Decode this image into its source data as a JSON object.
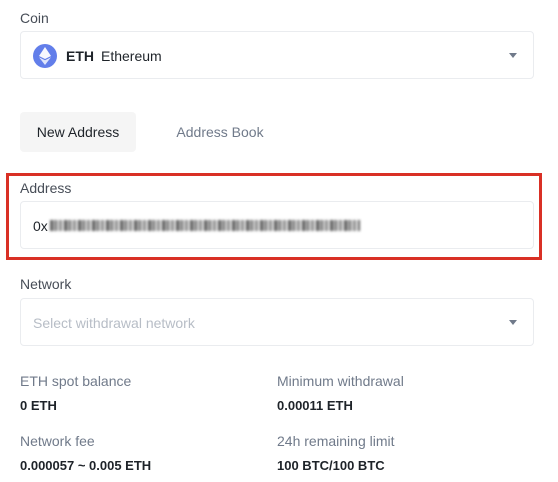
{
  "coin": {
    "label": "Coin",
    "symbol": "ETH",
    "name": "Ethereum",
    "icon": "ethereum-icon",
    "icon_color": "#627eea"
  },
  "tabs": [
    {
      "label": "New Address",
      "active": true
    },
    {
      "label": "Address Book",
      "active": false
    }
  ],
  "address": {
    "label": "Address",
    "prefix": "0x",
    "highlight_color": "#d93025"
  },
  "network": {
    "label": "Network",
    "placeholder": "Select withdrawal network"
  },
  "info": {
    "spot_balance_label": "ETH spot balance",
    "spot_balance_value": "0 ETH",
    "min_withdrawal_label": "Minimum withdrawal",
    "min_withdrawal_value": "0.00011 ETH",
    "network_fee_label": "Network fee",
    "network_fee_value": "0.000057 ~ 0.005 ETH",
    "remaining_limit_label": "24h remaining limit",
    "remaining_limit_value": "100 BTC/100 BTC"
  }
}
